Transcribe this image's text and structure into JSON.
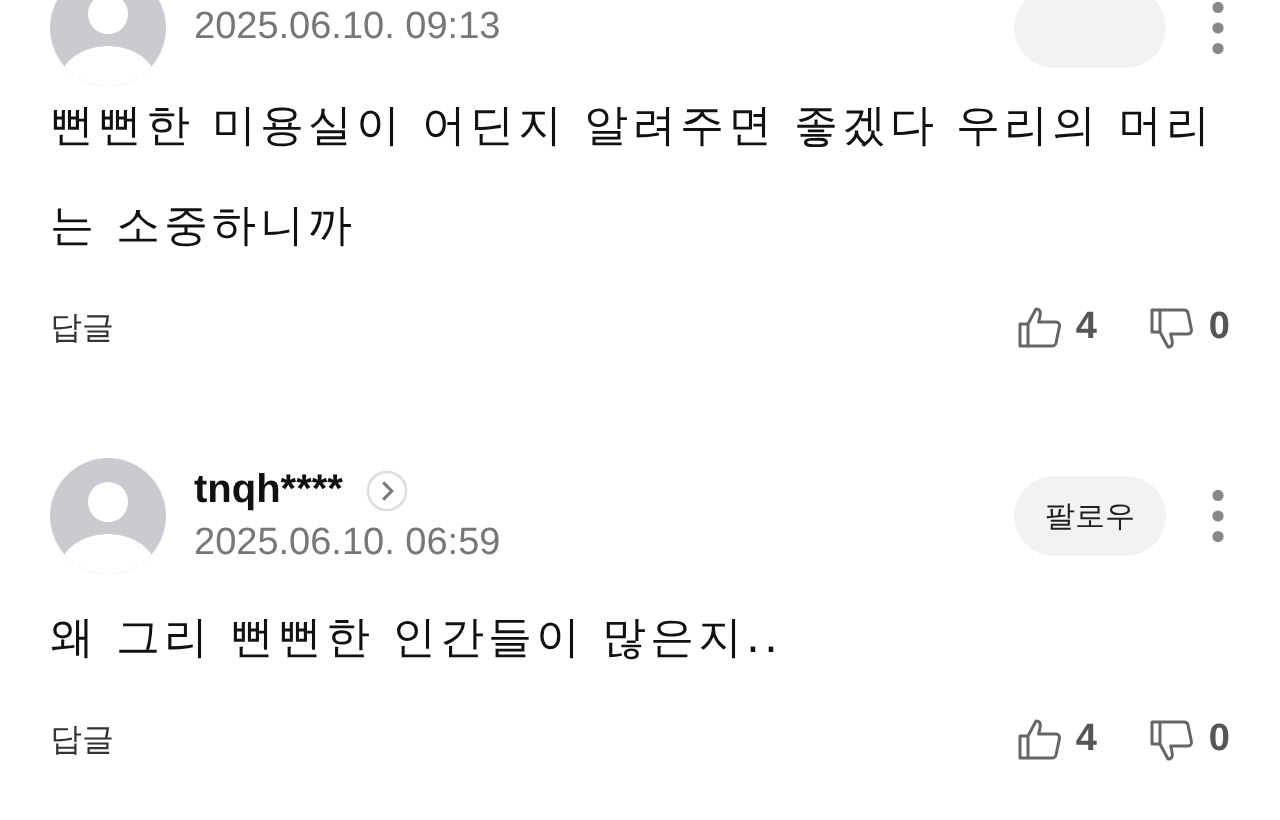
{
  "comments": [
    {
      "date": "2025.06.10. 09:13",
      "body": "뻔뻔한 미용실이 어딘지 알려주면 좋겠다 우리의 머리는 소중하니까",
      "reply": "답글",
      "likes": "4",
      "dislikes": "0"
    },
    {
      "username": "tnqh****",
      "follow": "팔로우",
      "date": "2025.06.10. 06:59",
      "body": "왜 그리 뻔뻔한 인간들이 많은지..",
      "reply": "답글",
      "likes": "4",
      "dislikes": "0"
    }
  ]
}
